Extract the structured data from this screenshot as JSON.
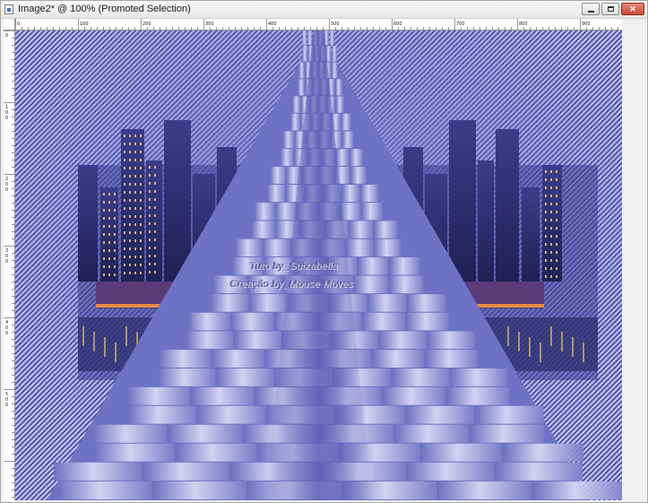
{
  "window": {
    "title": "Image2* @ 100% (Promoted Selection)",
    "controls": {
      "minimize": "minimize-button",
      "maximize": "maximize-button",
      "close": "close-button"
    },
    "close_glyph": "✕"
  },
  "ruler": {
    "horizontal_labels": [
      "0",
      "100",
      "200",
      "300",
      "400",
      "500",
      "600",
      "700",
      "800",
      "900"
    ],
    "vertical_labels": [
      "0",
      "100",
      "200",
      "300",
      "400",
      "500"
    ]
  },
  "canvas": {
    "image": "city-skyline-perspective-tiles",
    "watermark": {
      "line1": "Tuto by_Suizabella",
      "line2": "Creação by_Mouse Moves"
    },
    "colors": {
      "base": "#5a5fb4",
      "tile_light": "#d9dcf5",
      "tile_dark": "#6b6fc0",
      "stripe": "#c7cbee"
    }
  }
}
